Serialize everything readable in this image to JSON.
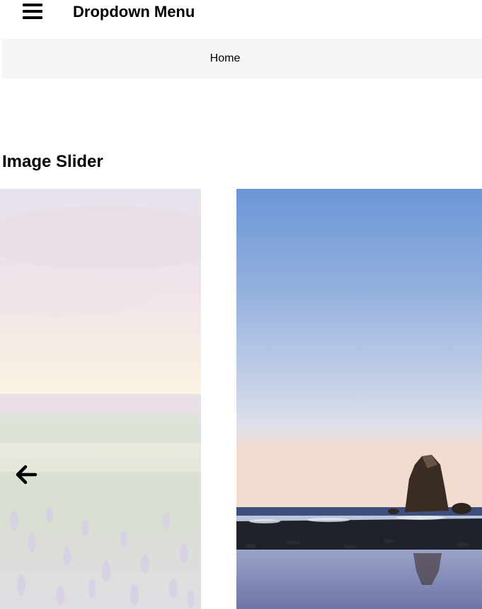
{
  "header": {
    "menu_icon": "hamburger-menu-icon",
    "title": "Dropdown Menu"
  },
  "nav": {
    "items": [
      {
        "label": "Home"
      }
    ],
    "background": "#f5f5f3"
  },
  "slider_section": {
    "heading": "Image Slider",
    "slides": [
      {
        "subject": "meadow-sunset-with-lavender-flowers",
        "faded": true
      },
      {
        "subject": "beach-sea-stack-rock-blue-sky",
        "faded": false
      }
    ],
    "prev_icon": "arrow-left-icon"
  }
}
